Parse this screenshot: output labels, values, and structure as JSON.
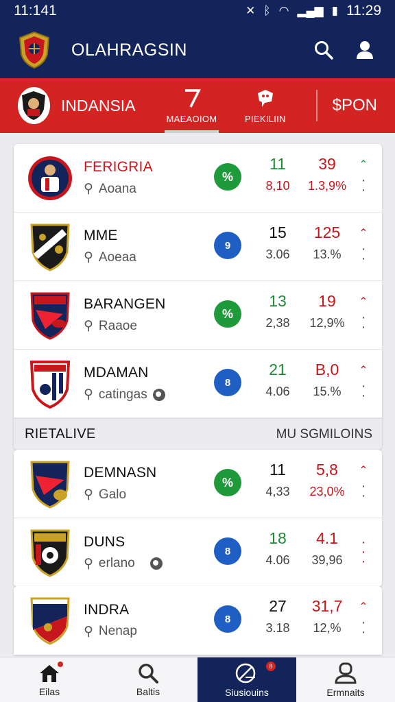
{
  "status_bar": {
    "time_left": "11:141",
    "time_right": "11:29",
    "icons": [
      "mute-icon",
      "bluetooth-icon",
      "wifi-icon",
      "signal-icon",
      "battery-icon"
    ]
  },
  "header": {
    "title": "OLAHRAGSIN",
    "icons": [
      "search-icon",
      "profile-icon"
    ]
  },
  "subheader": {
    "team": "INDANSIA",
    "tabs": [
      {
        "label": "MAEAOIOM",
        "icon": "seven-icon",
        "active": true
      },
      {
        "label": "PIEKILIIN",
        "icon": "chat-icon",
        "active": false
      }
    ],
    "action": "$PON"
  },
  "card1": {
    "rows": [
      {
        "name": "FERIGRIA",
        "sub": "Aoana",
        "icon_text": "%",
        "icon_color": "green",
        "v1": "11",
        "v1_sub": "8,10",
        "v2": "39",
        "v2_sub": "1.3,9%",
        "name_red": true,
        "v1_green": true,
        "v1_sub_red": true,
        "v2_sub_red": true,
        "trend": "up-green"
      },
      {
        "name": "MME",
        "sub": "Aoeaa",
        "icon_text": "9",
        "icon_color": "blue",
        "v1": "15",
        "v1_sub": "3.06",
        "v2": "125",
        "v2_sub": "13.%",
        "name_red": false,
        "v1_green": false,
        "v1_sub_red": false,
        "v2_sub_red": false,
        "trend": "up-red"
      },
      {
        "name": "BARANGEN",
        "sub": "Raaoe",
        "icon_text": "%",
        "icon_color": "green",
        "v1": "13",
        "v1_sub": "2,38",
        "v2": "19",
        "v2_sub": "12,9%",
        "name_red": false,
        "v1_green": true,
        "v1_sub_red": false,
        "v2_sub_red": false,
        "trend": "up-red"
      },
      {
        "name": "MDAMAN",
        "sub": "catingas",
        "icon_text": "8",
        "icon_color": "blue",
        "v1": "21",
        "v1_sub": "4.06",
        "v2": "B,0",
        "v2_sub": "15.%",
        "name_red": false,
        "v1_green": true,
        "v1_sub_red": false,
        "v2_sub_red": false,
        "trend": "up-red"
      }
    ],
    "section": {
      "left": "RIETALIVE",
      "right": "MU SGMILOINS"
    }
  },
  "card2": {
    "rows": [
      {
        "name": "DEMNASN",
        "sub": "Galo",
        "icon_text": "%",
        "icon_color": "green",
        "v1": "11",
        "v1_sub": "4,33",
        "v2": "5,8",
        "v2_sub": "23,0%",
        "name_red": false,
        "v1_green": false,
        "v1_sub_red": false,
        "v2_sub_red": true,
        "trend": "up-red"
      },
      {
        "name": "DUNS",
        "sub": "erlano",
        "icon_text": "8",
        "icon_color": "blue",
        "v1": "18",
        "v1_sub": "4.06",
        "v2": "4.1",
        "v2_sub": "39,96",
        "name_red": false,
        "v1_green": true,
        "v1_sub_red": false,
        "v2_sub_red": false,
        "trend": "dots-red"
      }
    ]
  },
  "card3": {
    "rows": [
      {
        "name": "INDRA",
        "sub": "Nenap",
        "icon_text": "8",
        "icon_color": "blue",
        "v1": "27",
        "v1_sub": "3.18",
        "v2": "31,7",
        "v2_sub": "12,%",
        "name_red": false,
        "v1_green": false,
        "v1_sub_red": false,
        "v2_sub_red": false,
        "trend": "up-red"
      }
    ]
  },
  "bottom_nav": [
    {
      "label": "Eilas",
      "icon": "home-icon",
      "badge": ""
    },
    {
      "label": "Baltis",
      "icon": "search-icon",
      "badge": ""
    },
    {
      "label": "Siusiouins",
      "icon": "ball-icon",
      "badge": "8",
      "active": true
    },
    {
      "label": "Ermnaits",
      "icon": "profile-icon",
      "badge": ""
    }
  ],
  "colors": {
    "navy": "#13245a",
    "red": "#d42323",
    "green": "#1e9a3a",
    "blue": "#1f5fc4"
  }
}
